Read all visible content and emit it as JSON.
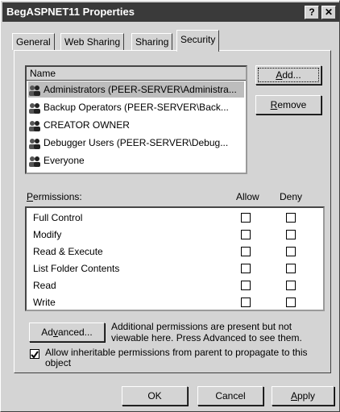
{
  "window": {
    "title": "BegASPNET11 Properties",
    "help_label": "?",
    "close_label": "✕"
  },
  "tabs": [
    {
      "label": "General"
    },
    {
      "label": "Web Sharing"
    },
    {
      "label": "Sharing"
    },
    {
      "label": "Security",
      "active": true
    }
  ],
  "users": {
    "header": "Name",
    "items": [
      {
        "label": "Administrators (PEER-SERVER\\Administra...",
        "selected": true
      },
      {
        "label": "Backup Operators (PEER-SERVER\\Back..."
      },
      {
        "label": "CREATOR OWNER"
      },
      {
        "label": "Debugger Users (PEER-SERVER\\Debug..."
      },
      {
        "label": "Everyone"
      }
    ],
    "icon": "users-icon"
  },
  "buttons": {
    "add": "Add...",
    "remove": "Remove",
    "advanced": "Advanced...",
    "ok": "OK",
    "cancel": "Cancel",
    "apply": "Apply"
  },
  "permissions": {
    "label": "Permissions:",
    "allow_header": "Allow",
    "deny_header": "Deny",
    "rows": [
      {
        "label": "Full Control",
        "allow": false,
        "deny": false
      },
      {
        "label": "Modify",
        "allow": false,
        "deny": false
      },
      {
        "label": "Read & Execute",
        "allow": false,
        "deny": false
      },
      {
        "label": "List Folder Contents",
        "allow": false,
        "deny": false
      },
      {
        "label": "Read",
        "allow": false,
        "deny": false
      },
      {
        "label": "Write",
        "allow": false,
        "deny": false
      }
    ]
  },
  "advanced_note_1": "Additional permissions are present but not",
  "advanced_note_2": "viewable here. Press Advanced to see them.",
  "inherit": {
    "line1": "Allow inheritable permissions from parent to propagate to this",
    "line2": "object",
    "checked": true
  }
}
